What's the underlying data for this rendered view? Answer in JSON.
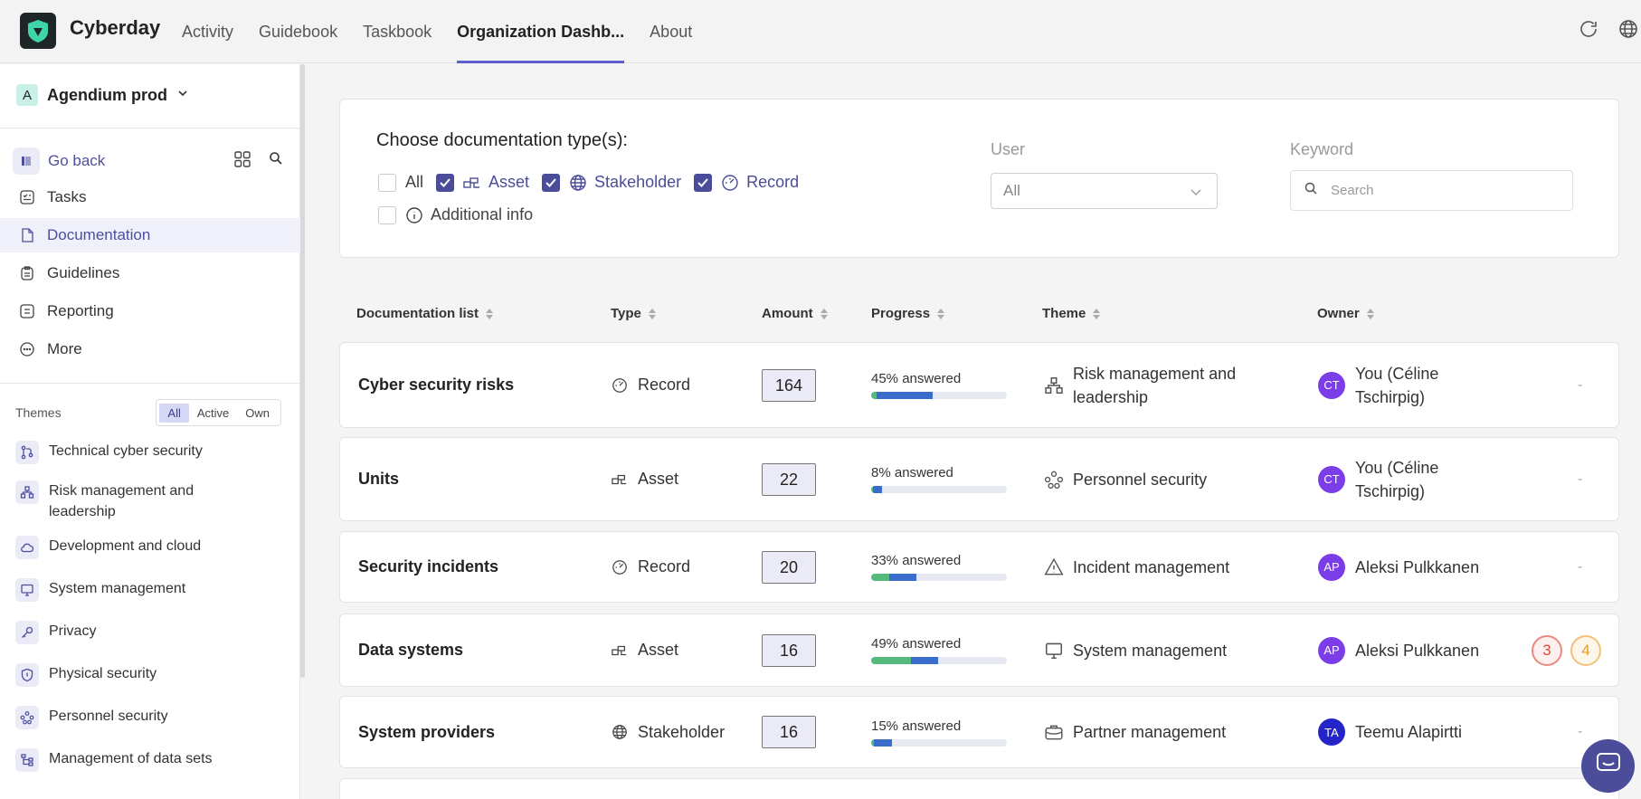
{
  "app": {
    "brand": "Cyberday",
    "nav": [
      "Activity",
      "Guidebook",
      "Taskbook",
      "Organization Dashb...",
      "About"
    ],
    "active_nav": 3
  },
  "sidebar": {
    "org_initial": "A",
    "org_name": "Agendium prod",
    "go_back": "Go back",
    "menu": [
      "Tasks",
      "Documentation",
      "Guidelines",
      "Reporting",
      "More"
    ],
    "active_menu": 1,
    "themes_label": "Themes",
    "theme_filters": [
      "All",
      "Active",
      "Own"
    ],
    "themes": [
      "Technical cyber security",
      "Risk management and leadership",
      "Development and cloud",
      "System management",
      "Privacy",
      "Physical security",
      "Personnel security",
      "Management of data sets"
    ]
  },
  "filters": {
    "title": "Choose documentation type(s):",
    "types": [
      {
        "label": "All",
        "checked": false
      },
      {
        "label": "Asset",
        "checked": true
      },
      {
        "label": "Stakeholder",
        "checked": true
      },
      {
        "label": "Record",
        "checked": true
      },
      {
        "label": "Additional info",
        "checked": false
      }
    ],
    "user_label": "User",
    "user_value": "All",
    "keyword_label": "Keyword",
    "search_placeholder": "Search"
  },
  "table": {
    "headers": [
      "Documentation list",
      "Type",
      "Amount",
      "Progress",
      "Theme",
      "Owner"
    ],
    "rows": [
      {
        "name": "Cyber security risks",
        "type": "Record",
        "amount": "164",
        "progress_label": "45% answered",
        "progress_green": 0.04,
        "progress_total": 0.45,
        "theme": "Risk management and leadership",
        "owner_initials": "CT",
        "owner": "You (Céline Tschirpig)",
        "extra": "-"
      },
      {
        "name": "Units",
        "type": "Asset",
        "amount": "22",
        "progress_label": "8% answered",
        "progress_green": 0.0,
        "progress_total": 0.08,
        "theme": "Personnel security",
        "owner_initials": "CT",
        "owner": "You (Céline Tschirpig)",
        "extra": "-"
      },
      {
        "name": "Security incidents",
        "type": "Record",
        "amount": "20",
        "progress_label": "33% answered",
        "progress_green": 0.13,
        "progress_total": 0.33,
        "theme": "Incident management",
        "owner_initials": "AP",
        "owner": "Aleksi Pulkkanen",
        "extra": "-"
      },
      {
        "name": "Data systems",
        "type": "Asset",
        "amount": "16",
        "progress_label": "49% answered",
        "progress_green": 0.29,
        "progress_total": 0.49,
        "theme": "System management",
        "owner_initials": "AP",
        "owner": "Aleksi Pulkkanen",
        "extra": "",
        "badges": [
          "3",
          "4"
        ]
      },
      {
        "name": "System providers",
        "type": "Stakeholder",
        "amount": "16",
        "progress_label": "15% answered",
        "progress_green": 0.02,
        "progress_total": 0.15,
        "theme": "Partner management",
        "owner_initials": "TA",
        "owner": "Teemu Alapirtti",
        "extra": "-"
      }
    ]
  },
  "colors": {
    "accent": "#4b4d9a",
    "progress_green": "#55b97e",
    "progress_blue": "#3a6ccb",
    "avatar_purple": "#7a3de8",
    "avatar_blue": "#2424c8"
  }
}
